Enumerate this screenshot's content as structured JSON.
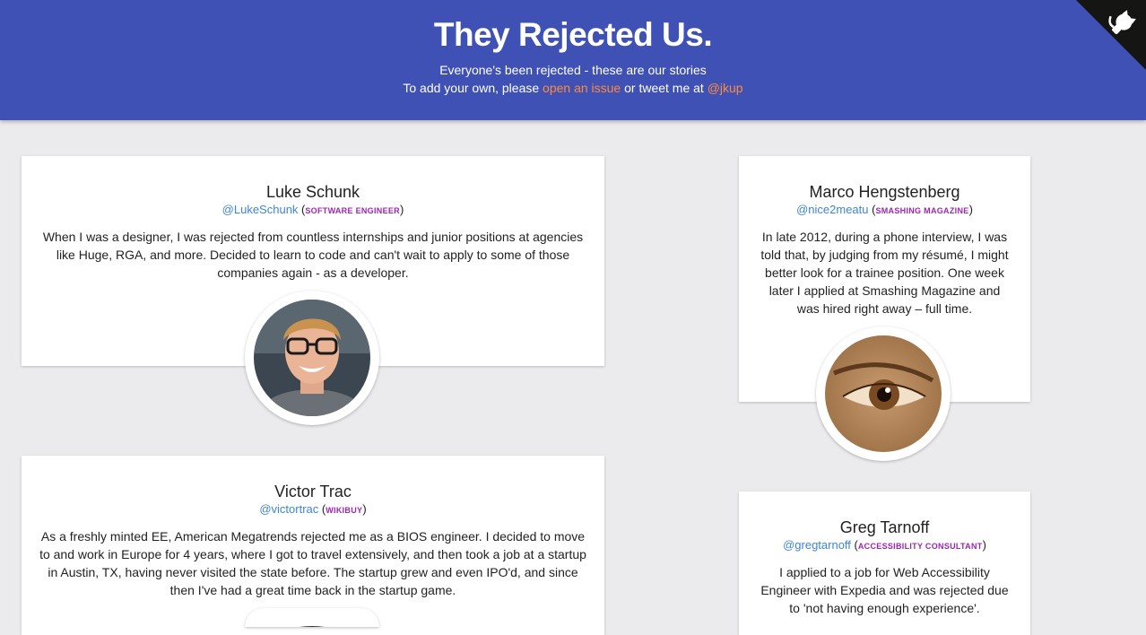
{
  "header": {
    "title": "They Rejected Us.",
    "subtitle": "Everyone's been rejected - these are our stories",
    "cta_prefix": "To add your own, please ",
    "cta_link": "open an issue",
    "cta_middle": " or tweet me at ",
    "cta_handle": "@jkup"
  },
  "corner_icon": "github-octocat-icon",
  "colors": {
    "header_bg": "#3f51b5",
    "link_orange": "#ff8a3d",
    "handle_blue": "#3d85d8",
    "company_purple": "#9c27b0",
    "page_bg": "#ebebed"
  },
  "stories": [
    {
      "name": "Luke Schunk",
      "handle": "@LukeSchunk",
      "company": "Software Engineer",
      "story": "When I was a designer, I was rejected from countless internships and junior positions at agencies like Huge, RGA, and more. Decided to learn to code and can't wait to apply to some of those companies again - as a developer."
    },
    {
      "name": "Marco Hengstenberg",
      "handle": "@nice2meatu",
      "company": "Smashing Magazine",
      "story": "In late 2012, during a phone interview, I was told that, by judging from my résumé, I might better look for a trainee position. One week later I applied at Smashing Magazine and was hired right away – full time."
    },
    {
      "name": "Victor Trac",
      "handle": "@victortrac",
      "company": "Wikibuy",
      "story": "As a freshly minted EE, American Megatrends rejected me as a BIOS engineer. I decided to move to and work in Europe for 4 years, where I got to travel extensively, and then took a job at a startup in Austin, TX, having never visited the state before. The startup grew and even IPO'd, and since then I've had a great time back in the startup game."
    },
    {
      "name": "Greg Tarnoff",
      "handle": "@gregtarnoff",
      "company": "Accessibility Consultant",
      "story": "I applied to a job for Web Accessibility Engineer with Expedia and was rejected due to 'not having enough experience'."
    }
  ]
}
